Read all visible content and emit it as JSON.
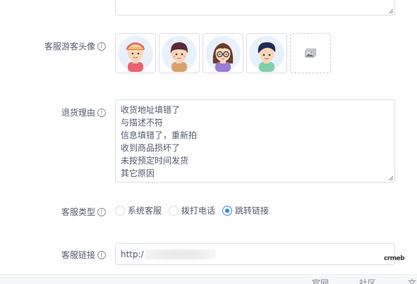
{
  "form": {
    "avatar": {
      "label": "客服游客头像",
      "info_icon": "info-icon",
      "avatars": [
        {
          "name": "avatar-boy-cap",
          "hair": "#e96b5b",
          "skin": "#f9d7b9",
          "shirt": "#e8636f"
        },
        {
          "name": "avatar-boy-bowl",
          "hair": "#5a2a3a",
          "skin": "#f9d7b9",
          "shirt": "#d9a06a"
        },
        {
          "name": "avatar-girl-glasses",
          "hair": "#6b3a2a",
          "skin": "#f9d7b9",
          "shirt": "#9a7bd6"
        },
        {
          "name": "avatar-boy-side",
          "hair": "#1d2a5a",
          "skin": "#f9d7b9",
          "shirt": "#7fd0a8"
        }
      ],
      "upload_icon": "image-upload-icon"
    },
    "return_reason": {
      "label": "退货理由",
      "lines": [
        "收货地址填错了",
        "与描述不符",
        "信息填错了，重新拍",
        "收到商品损坏了",
        "未按预定时间发货",
        "其它原因"
      ]
    },
    "service_type": {
      "label": "客服类型",
      "options": [
        {
          "label": "系统客服",
          "checked": false
        },
        {
          "label": "拨打电话",
          "checked": false
        },
        {
          "label": "跳转链接",
          "checked": true
        }
      ]
    },
    "service_link": {
      "label": "客服链接",
      "value": "http:/"
    }
  },
  "watermark": "crmeb",
  "footer": {
    "links": [
      "官网",
      "社区",
      "文"
    ]
  },
  "colors": {
    "accent": "#2d8cf0",
    "border": "#dcdee2",
    "text": "#515a6e"
  }
}
